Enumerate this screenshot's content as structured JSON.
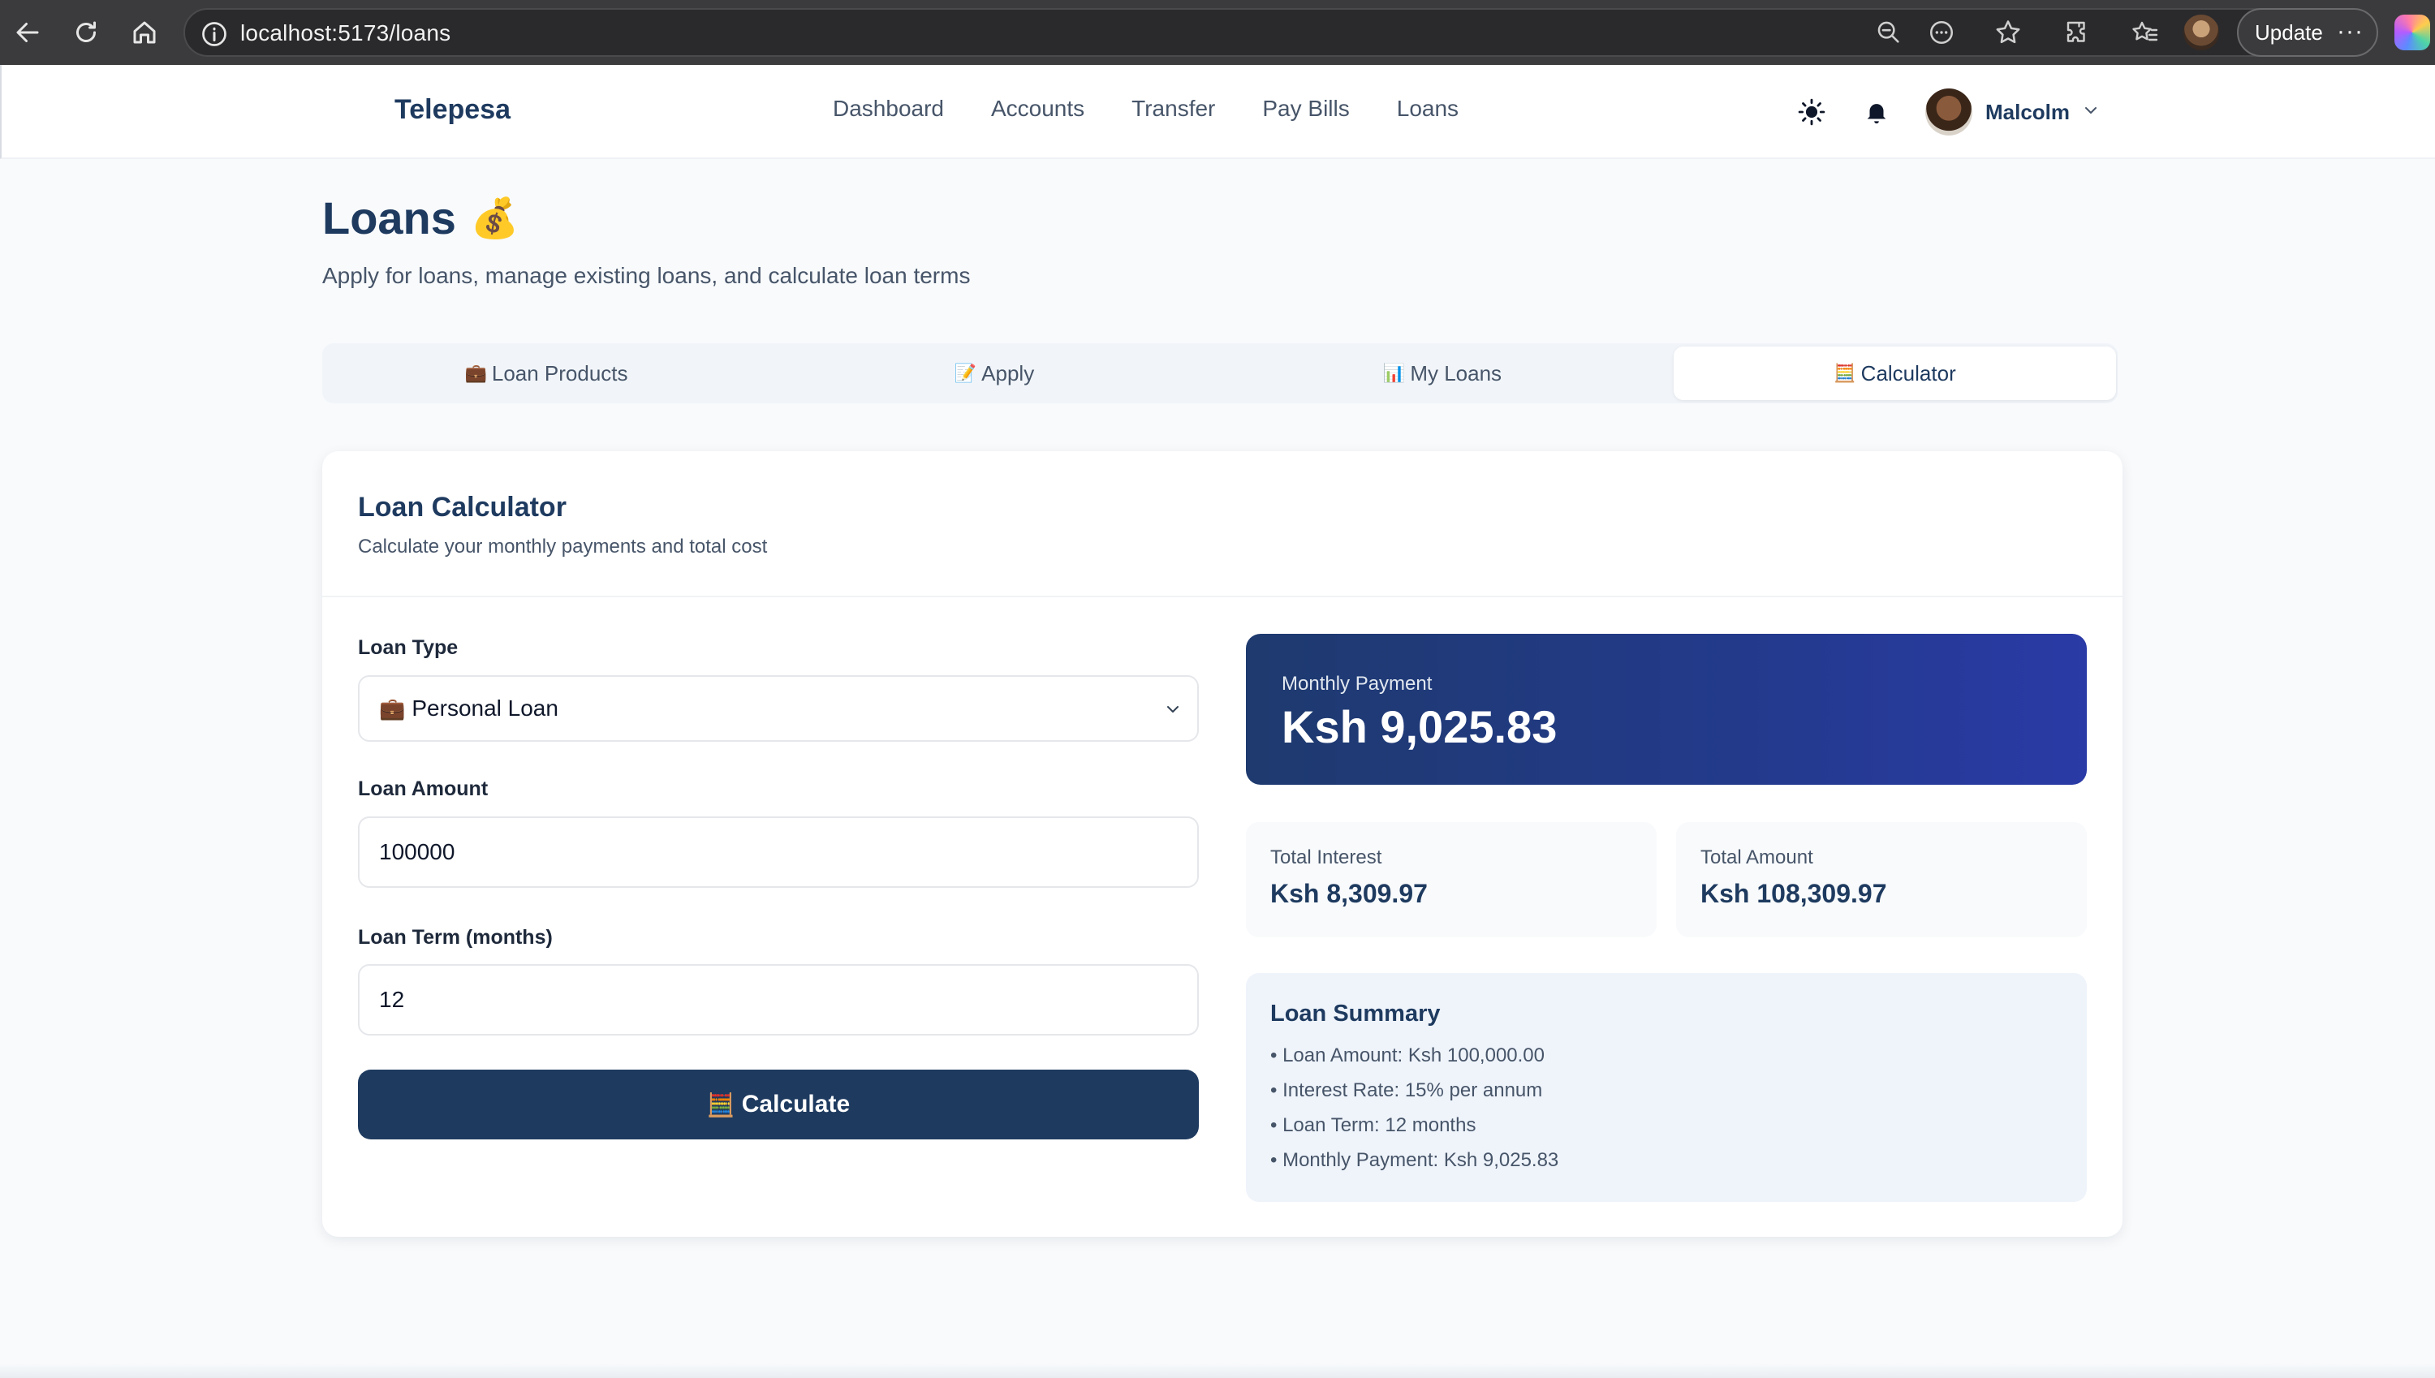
{
  "browser": {
    "url": "localhost:5173/loans",
    "update_label": "Update",
    "more_label": "···"
  },
  "header": {
    "brand": "Telepesa",
    "nav": [
      "Dashboard",
      "Accounts",
      "Transfer",
      "Pay Bills",
      "Loans"
    ],
    "user_name": "Malcolm"
  },
  "page": {
    "title": "Loans",
    "title_emoji": "💰",
    "subtitle": "Apply for loans, manage existing loans, and calculate loan terms"
  },
  "tabs": [
    {
      "icon": "💼",
      "label": "Loan Products"
    },
    {
      "icon": "📝",
      "label": "Apply"
    },
    {
      "icon": "📊",
      "label": "My Loans"
    },
    {
      "icon": "🧮",
      "label": "Calculator",
      "active": true
    }
  ],
  "calculator": {
    "title": "Loan Calculator",
    "subtitle": "Calculate your monthly payments and total cost",
    "loan_type_label": "Loan Type",
    "loan_type_icon": "💼",
    "loan_type_value": "Personal Loan",
    "amount_label": "Loan Amount",
    "amount_value": "100000",
    "term_label": "Loan Term (months)",
    "term_value": "12",
    "button_icon": "🧮",
    "button_label": "Calculate"
  },
  "results": {
    "monthly_label": "Monthly Payment",
    "monthly_value": "Ksh 9,025.83",
    "interest_label": "Total Interest",
    "interest_value": "Ksh 8,309.97",
    "total_label": "Total Amount",
    "total_value": "Ksh 108,309.97",
    "summary_title": "Loan Summary",
    "summary_items": [
      "Loan Amount: Ksh 100,000.00",
      "Interest Rate: 15% per annum",
      "Loan Term: 12 months",
      "Monthly Payment: Ksh 9,025.83"
    ]
  },
  "colors": {
    "primary": "#1e3a5f",
    "gradient_end": "#2a3aa6"
  }
}
